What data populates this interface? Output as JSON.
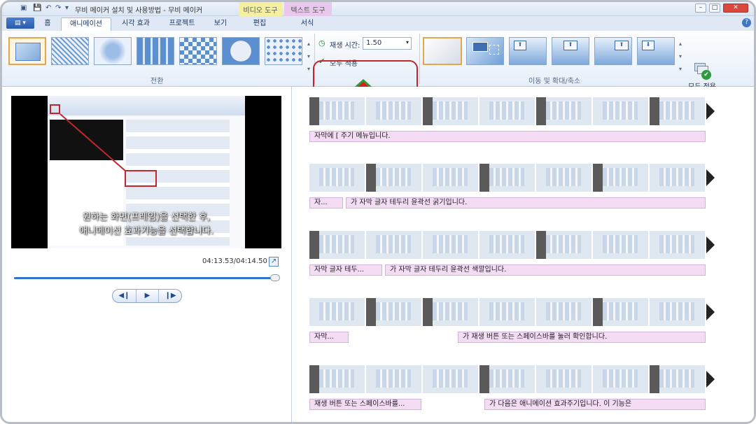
{
  "window": {
    "title": "무비 메이커 설치 및 사용방법 - 무비 메이커",
    "context_tab_video": "비디오 도구",
    "context_tab_text": "텍스트 도구"
  },
  "tabs": [
    "홈",
    "애니메이션",
    "시각 효과",
    "프로젝트",
    "보기",
    "편집",
    "서식"
  ],
  "active_tab": "애니메이션",
  "ribbon": {
    "transitions_group": "전환",
    "pan_zoom_group": "이동 및 확대/축소",
    "duration_label": "재생 시간:",
    "duration_value": "1.50",
    "apply_all_small": "모두 적용",
    "apply_all_big": "모두 적용"
  },
  "preview": {
    "subtitle_line1": "원하는 화면(프레임)을 선택한 후,",
    "subtitle_line2": "애니메이션 효과기능을 선택합니다.",
    "time": "04:13.53/04:14.50",
    "progress": 0.996
  },
  "tracks": [
    {
      "captions": [
        {
          "text": "자막에 [ 주기 메뉴입니다."
        }
      ]
    },
    {
      "captions": [
        {
          "text": "자..."
        },
        {
          "text": "가 자막 글자 테두리 윤곽선 굵기입니다."
        }
      ]
    },
    {
      "captions": [
        {
          "text": "자막 글자 테두..."
        },
        {
          "text": "가 자막 글자 테두리 윤곽선 색깔입니다."
        }
      ]
    },
    {
      "captions": [
        {
          "text": "자막..."
        },
        {
          "text": "가 재생 버튼 또는 스페이스바를 눌러 확인합니다."
        }
      ]
    },
    {
      "captions": [
        {
          "text": "재생 버튼 또는 스페이스바를..."
        },
        {
          "text": "가 다음은 애니메이션 효과주기입니다. 이 기능은"
        }
      ]
    }
  ],
  "colors": {
    "highlight": "#c0272d",
    "arrow_fill": "#e11b1b",
    "arrow_stroke": "#2f9a3a",
    "caption_bg": "#f3dcf4"
  }
}
